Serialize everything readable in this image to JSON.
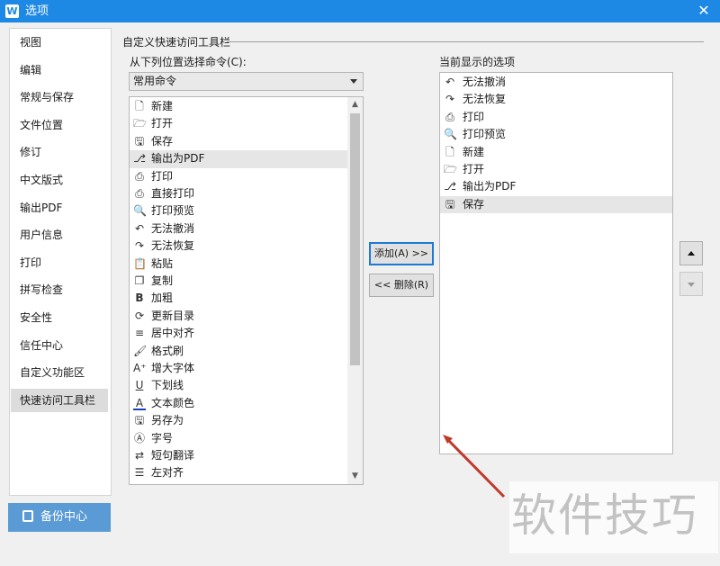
{
  "window": {
    "title": "选项",
    "app_icon": "W"
  },
  "sidebar": {
    "items": [
      {
        "label": "视图"
      },
      {
        "label": "编辑"
      },
      {
        "label": "常规与保存"
      },
      {
        "label": "文件位置"
      },
      {
        "label": "修订"
      },
      {
        "label": "中文版式"
      },
      {
        "label": "输出PDF"
      },
      {
        "label": "用户信息"
      },
      {
        "label": "打印"
      },
      {
        "label": "拼写检查"
      },
      {
        "label": "安全性"
      },
      {
        "label": "信任中心"
      },
      {
        "label": "自定义功能区"
      },
      {
        "label": "快速访问工具栏"
      }
    ],
    "active": "快速访问工具栏"
  },
  "backup": {
    "label": "备份中心"
  },
  "panel": {
    "group_title": "自定义快速访问工具栏",
    "from_label": "从下列位置选择命令(C):",
    "dropdown_value": "常用命令",
    "current_label": "当前显示的选项",
    "add_label": "添加(A) >>",
    "delete_label": "<< 删除(R)"
  },
  "commands": [
    {
      "label": "新建",
      "icon": "new-doc-icon"
    },
    {
      "label": "打开",
      "icon": "folder-icon"
    },
    {
      "label": "保存",
      "icon": "save-icon"
    },
    {
      "label": "输出为PDF",
      "icon": "pdf-export-icon"
    },
    {
      "label": "打印",
      "icon": "printer-icon"
    },
    {
      "label": "直接打印",
      "icon": "direct-print-icon"
    },
    {
      "label": "打印预览",
      "icon": "print-preview-icon"
    },
    {
      "label": "无法撤消",
      "icon": "undo-icon"
    },
    {
      "label": "无法恢复",
      "icon": "redo-icon"
    },
    {
      "label": "粘贴",
      "icon": "paste-icon"
    },
    {
      "label": "复制",
      "icon": "copy-icon"
    },
    {
      "label": "加粗",
      "icon": "bold-icon"
    },
    {
      "label": "更新目录",
      "icon": "update-toc-icon"
    },
    {
      "label": "居中对齐",
      "icon": "align-center-icon"
    },
    {
      "label": "格式刷",
      "icon": "format-painter-icon"
    },
    {
      "label": "增大字体",
      "icon": "font-grow-icon"
    },
    {
      "label": "下划线",
      "icon": "underline-icon"
    },
    {
      "label": "文本颜色",
      "icon": "text-color-icon"
    },
    {
      "label": "另存为",
      "icon": "save-as-icon"
    },
    {
      "label": "字号",
      "icon": "font-size-icon"
    },
    {
      "label": "短句翻译",
      "icon": "translate-icon"
    },
    {
      "label": "左对齐",
      "icon": "align-left-icon"
    }
  ],
  "commands_selected": "输出为PDF",
  "current_items": [
    {
      "label": "无法撤消",
      "icon": "undo-icon"
    },
    {
      "label": "无法恢复",
      "icon": "redo-icon"
    },
    {
      "label": "打印",
      "icon": "printer-icon"
    },
    {
      "label": "打印预览",
      "icon": "print-preview-icon"
    },
    {
      "label": "新建",
      "icon": "new-doc-icon"
    },
    {
      "label": "打开",
      "icon": "folder-icon"
    },
    {
      "label": "输出为PDF",
      "icon": "pdf-export-icon"
    },
    {
      "label": "保存",
      "icon": "save-icon"
    }
  ],
  "current_selected": "保存",
  "watermark": {
    "text": "软件技巧"
  },
  "colors": {
    "titlebar": "#1e88e5",
    "backup": "#5b9bd5",
    "annotation_arrow": "#c0392b"
  }
}
